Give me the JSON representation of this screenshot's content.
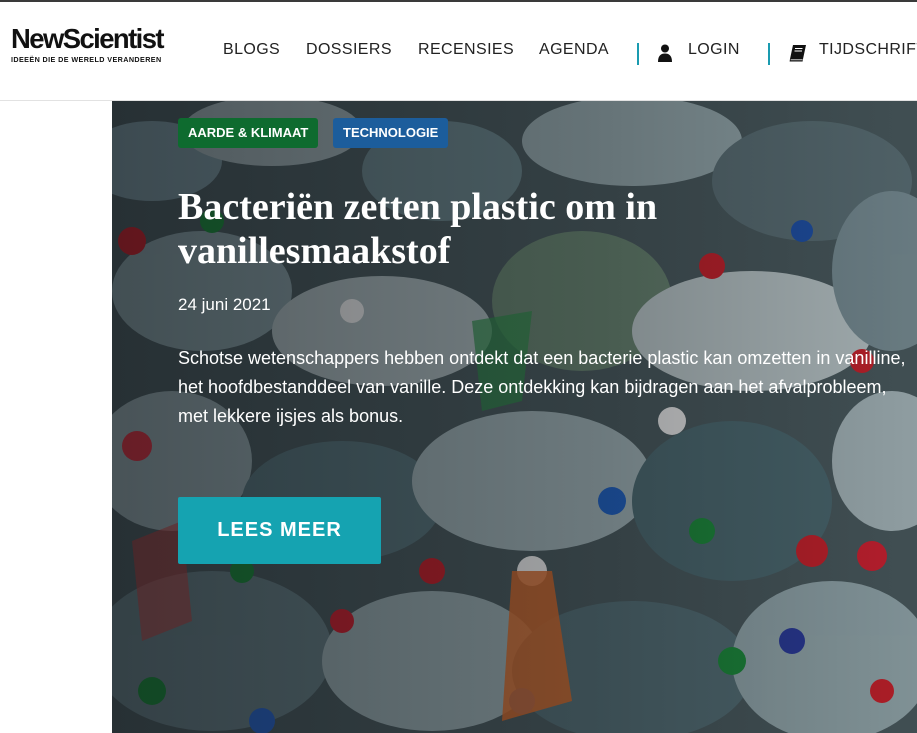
{
  "header": {
    "logo_name": "NewScientist",
    "logo_tagline": "IDEEËN DIE DE WERELD VERANDEREN",
    "nav": [
      "BLOGS",
      "DOSSIERS",
      "RECENSIES",
      "AGENDA"
    ],
    "login_label": "LOGIN",
    "login_icon": "user-icon",
    "magazine_label": "TIJDSCHRIFT",
    "magazine_icon": "book-icon",
    "accent_color": "#1a9bb0"
  },
  "hero": {
    "tags": [
      {
        "label": "AARDE & KLIMAAT",
        "color": "#0e6b2f"
      },
      {
        "label": "TECHNOLOGIE",
        "color": "#1c5d9c"
      }
    ],
    "title": "Bacteriën zetten plastic om in vanillesmaakstof",
    "date": "24 juni 2021",
    "summary": "Schotse wetenschappers hebben ontdekt dat een bacterie plastic kan omzetten in vanilline, het hoofdbestanddeel van vanille. Deze ontdekking kan bijdragen aan het afvalprobleem, met lekkere ijsjes als bonus.",
    "cta_label": "LEES MEER",
    "cta_color": "#15a3b1"
  }
}
